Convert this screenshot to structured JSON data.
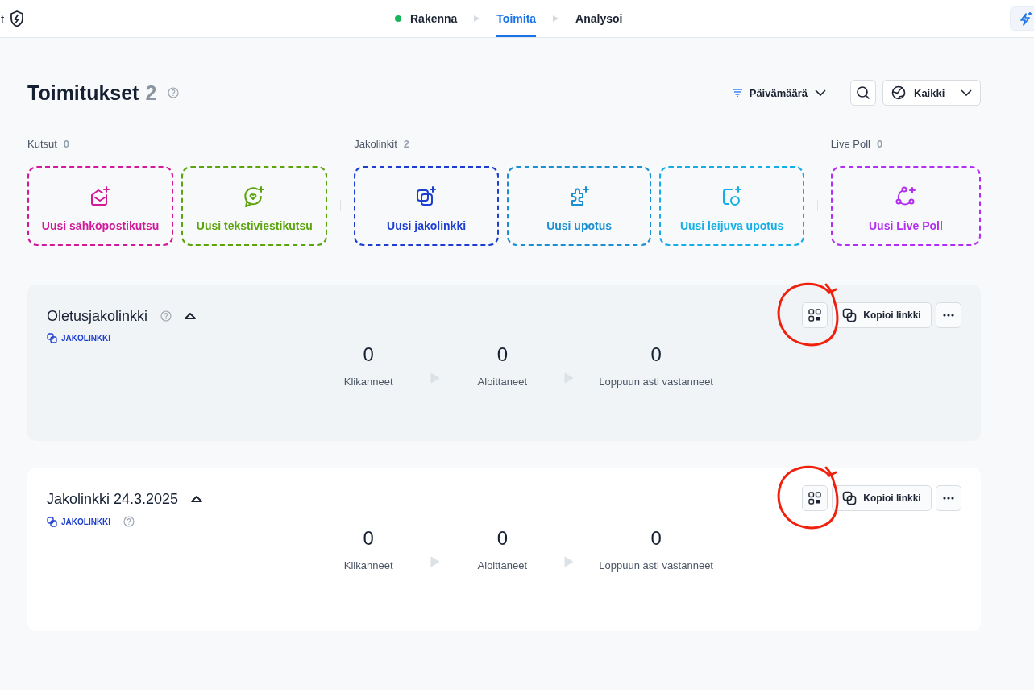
{
  "topbar": {
    "left_text": "t",
    "steps": [
      {
        "label": "Rakenna",
        "done": true,
        "selected": false
      },
      {
        "label": "Toimita",
        "done": false,
        "selected": true
      },
      {
        "label": "Analysoi",
        "done": false,
        "selected": false
      }
    ]
  },
  "page": {
    "title": "Toimitukset",
    "count": "2",
    "sort_label": "Päivämäärä",
    "filter_label": "Kaikki"
  },
  "groups": [
    {
      "label": "Kutsut",
      "count": "0",
      "tiles": [
        {
          "label": "Uusi sähköpostikutsu",
          "kind": "email",
          "color": "#d1199a"
        },
        {
          "label": "Uusi tekstiviestikutsu",
          "kind": "sms",
          "color": "#5ba40c"
        }
      ]
    },
    {
      "label": "Jakolinkit",
      "count": "2",
      "tiles": [
        {
          "label": "Uusi jakolinkki",
          "kind": "link",
          "color": "#1d3fd1"
        },
        {
          "label": "Uusi upotus",
          "kind": "embed",
          "color": "#1a8fd1"
        },
        {
          "label": "Uusi leijuva upotus",
          "kind": "popup",
          "color": "#14aee6"
        }
      ]
    },
    {
      "label": "Live Poll",
      "count": "0",
      "tiles": [
        {
          "label": "Uusi Live Poll",
          "kind": "poll",
          "color": "#b22ff0"
        }
      ]
    }
  ],
  "cards": [
    {
      "title": "Oletusjakolinkki",
      "title_help": true,
      "tag_help": false,
      "expanded": true,
      "highlighted": true,
      "annotated": true,
      "tag": "JAKOLINKKI",
      "copy_label": "Kopioi linkki",
      "stats": [
        {
          "value": "0",
          "label": "Klikanneet"
        },
        {
          "value": "0",
          "label": "Aloittaneet"
        },
        {
          "value": "0",
          "label": "Loppuun asti vastanneet"
        }
      ]
    },
    {
      "title": "Jakolinkki 24.3.2025",
      "title_help": false,
      "tag_help": true,
      "expanded": true,
      "highlighted": false,
      "annotated": true,
      "tag": "JAKOLINKKI",
      "copy_label": "Kopioi linkki",
      "stats": [
        {
          "value": "0",
          "label": "Klikanneet"
        },
        {
          "value": "0",
          "label": "Aloittaneet"
        },
        {
          "value": "0",
          "label": "Loppuun asti vastanneet"
        }
      ]
    }
  ]
}
